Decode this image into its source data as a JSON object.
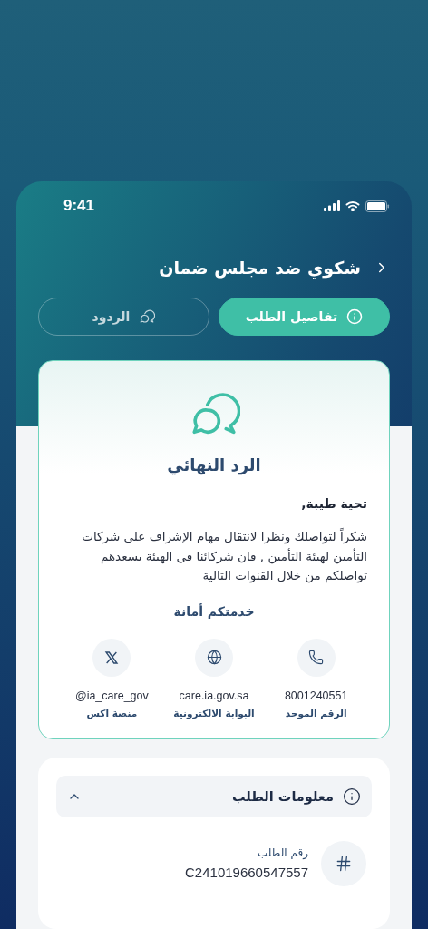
{
  "status_bar": {
    "time": "9:41"
  },
  "header": {
    "title": "شكوي ضد مجلس ضمان"
  },
  "tabs": [
    {
      "label": "تفاصيل الطلب",
      "kind": "info",
      "selected": true
    },
    {
      "label": "الردود",
      "kind": "chat",
      "selected": false
    }
  ],
  "reply_card": {
    "title": "الرد النهائي",
    "greeting": "تحية طيبة,",
    "body": "شكراً لتواصلك ونظرا لانتقال مهام الإشراف علي شركات التأمين لهيئة التأمين , فان شركائنا في الهيئة يسعدهم تواصلكم من خلال القنوات التالية",
    "divider_title": "خدمتكم أمانة",
    "channels": [
      {
        "kind": "phone",
        "value": "8001240551",
        "label": "الرقم الموحد"
      },
      {
        "kind": "web",
        "value": "care.ia.gov.sa",
        "label": "البوابة الالكترونية"
      },
      {
        "kind": "x",
        "value": "@ia_care_gov",
        "label": "منصة اكس"
      }
    ]
  },
  "info_section": {
    "title": "معلومات الطلب",
    "expanded": true,
    "fields": [
      {
        "kind": "number",
        "label": "رقم الطلب",
        "value": "C241019660547557"
      }
    ]
  }
}
